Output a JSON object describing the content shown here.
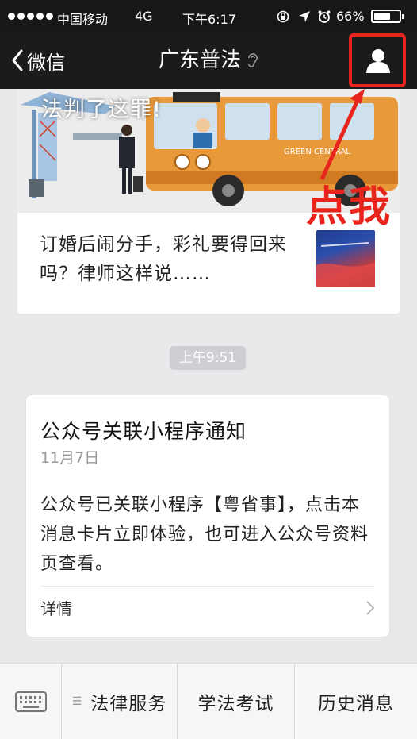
{
  "status_bar": {
    "carrier": "中国移动",
    "network": "4G",
    "time": "下午6:17",
    "battery": "66%",
    "battery_level": 0.66
  },
  "nav": {
    "back_label": "微信",
    "title": "广东普法",
    "icons": [
      "chevron-left-icon",
      "ear-icon",
      "user-profile-icon"
    ]
  },
  "article": {
    "overlay_text": "法判了这罪!",
    "bus_sign": "GREEN CENTRAL",
    "sub_title": "订婚后闹分手，彩礼要得回来吗？律师这样说……"
  },
  "annotation": {
    "label": "点我",
    "color": "#e8251c"
  },
  "timestamp": "上午9:51",
  "notice": {
    "title": "公众号关联小程序通知",
    "date": "11月7日",
    "body": "公众号已关联小程序【粤省事】，点击本消息卡片立即体验，也可进入公众号资料页查看。",
    "details_label": "详情"
  },
  "menu": {
    "keyboard_icon": "keyboard-icon",
    "items": [
      {
        "label": "法律服务",
        "has_submenu_glyph": true
      },
      {
        "label": "学法考试"
      },
      {
        "label": "历史消息"
      }
    ]
  },
  "colors": {
    "nav_bg": "#1b1b1e",
    "page_bg": "#e9e9ec",
    "accent_red": "#e8251c"
  }
}
